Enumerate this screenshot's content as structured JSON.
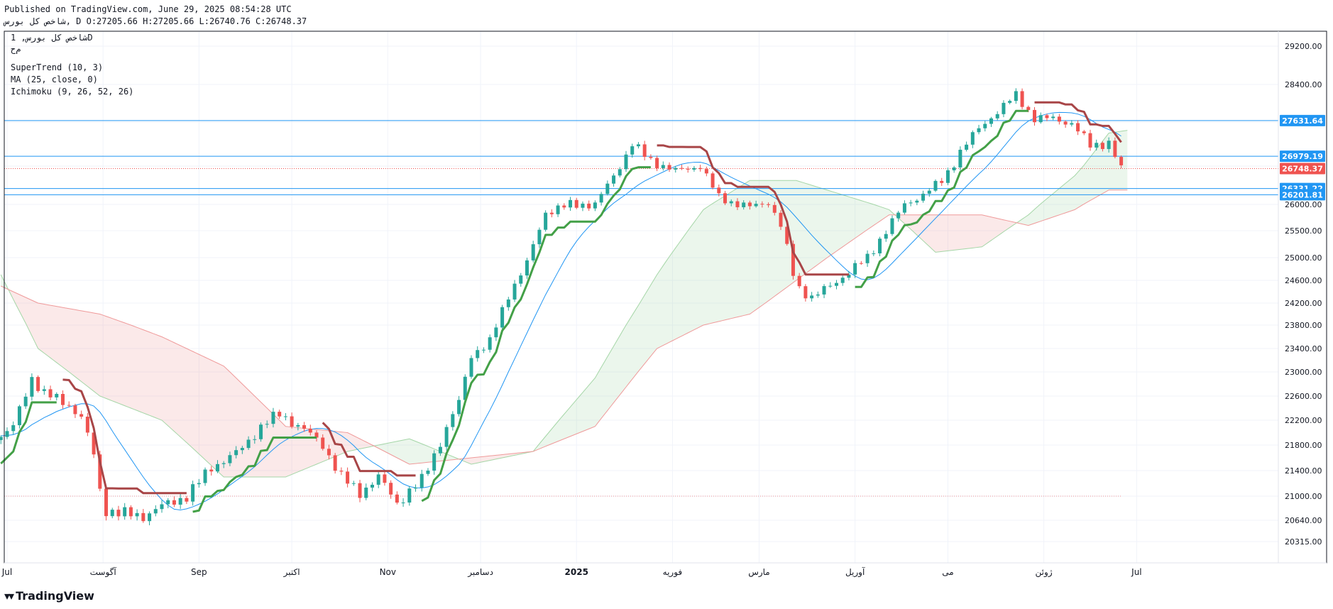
{
  "header": {
    "published": "Published on TradingView.com, June 29, 2025 08:54:28 UTC",
    "ohlc": "شاخص کل بورس, D O:27205.66 H:27205.66 L:26740.76 C:26748.37"
  },
  "legend": {
    "symbol": "شاخص کل بورس, 1D",
    "line2": "م‌ح",
    "supertrend": "SuperTrend (10, 3)",
    "ma": "MA (25, close, 0)",
    "ichimoku": "Ichimoku (9, 26, 52, 26)"
  },
  "footer": {
    "logo_icon": "tradingview-logo-icon",
    "brand": "TradingView"
  },
  "colors": {
    "up": "#26a69a",
    "down": "#ef5350",
    "st_up": "#43a047",
    "st_down": "#a84547",
    "ma": "#2196f3",
    "cloud_bull": "#a5d6a7",
    "cloud_bear": "#ef9a9a",
    "hline": "#2196f3"
  },
  "chart_data": {
    "type": "candlestick",
    "y_axis_ticks": [
      29200,
      28400,
      27600,
      26800,
      26000,
      25500,
      25000,
      24600,
      24200,
      23800,
      23400,
      23000,
      22600,
      22200,
      21800,
      21400,
      21000,
      20640,
      20315
    ],
    "x_axis_labels": [
      {
        "label": "Jul",
        "day": 0
      },
      {
        "label": "آگوست",
        "day": 31
      },
      {
        "label": "Sep",
        "day": 62
      },
      {
        "label": "اکتبر",
        "day": 92
      },
      {
        "label": "Nov",
        "day": 123
      },
      {
        "label": "دسامبر",
        "day": 153
      },
      {
        "label": "2025",
        "day": 184
      },
      {
        "label": "فوریه",
        "day": 215
      },
      {
        "label": "مارس",
        "day": 243
      },
      {
        "label": "آوریل",
        "day": 274
      },
      {
        "label": "می",
        "day": 304
      },
      {
        "label": "ژوئن",
        "day": 335
      },
      {
        "label": "Jul",
        "day": 365
      }
    ],
    "price_labels": [
      {
        "value": 27631.64,
        "text": "27631.64",
        "color": "#2196f3"
      },
      {
        "value": 26979.19,
        "text": "26979.19",
        "color": "#2196f3"
      },
      {
        "value": 26748.37,
        "text": "26748.37",
        "color": "#ef5350"
      },
      {
        "value": 26331.22,
        "text": "26331.22",
        "color": "#2196f3"
      },
      {
        "value": 26201.81,
        "text": "26201.81",
        "color": "#2196f3"
      }
    ],
    "horizontal_lines": [
      27631.64,
      26979.19,
      26331.22,
      26201.81
    ],
    "current_price": 26748.37,
    "reference_level": 21000,
    "trend_anchors": [
      {
        "day": -2,
        "price": 21950
      },
      {
        "day": 2,
        "price": 22100
      },
      {
        "day": 8,
        "price": 22900
      },
      {
        "day": 12,
        "price": 22650
      },
      {
        "day": 16,
        "price": 22550
      },
      {
        "day": 20,
        "price": 22450
      },
      {
        "day": 24,
        "price": 22250
      },
      {
        "day": 28,
        "price": 21650
      },
      {
        "day": 31,
        "price": 20800
      },
      {
        "day": 36,
        "price": 20750
      },
      {
        "day": 44,
        "price": 20700
      },
      {
        "day": 50,
        "price": 20850
      },
      {
        "day": 58,
        "price": 21000
      },
      {
        "day": 66,
        "price": 21450
      },
      {
        "day": 75,
        "price": 21700
      },
      {
        "day": 83,
        "price": 22150
      },
      {
        "day": 88,
        "price": 22300
      },
      {
        "day": 96,
        "price": 22050
      },
      {
        "day": 102,
        "price": 21800
      },
      {
        "day": 108,
        "price": 21300
      },
      {
        "day": 114,
        "price": 21050
      },
      {
        "day": 120,
        "price": 21300
      },
      {
        "day": 126,
        "price": 20900
      },
      {
        "day": 134,
        "price": 21250
      },
      {
        "day": 140,
        "price": 21850
      },
      {
        "day": 146,
        "price": 22500
      },
      {
        "day": 150,
        "price": 23300
      },
      {
        "day": 156,
        "price": 23500
      },
      {
        "day": 162,
        "price": 24350
      },
      {
        "day": 168,
        "price": 24900
      },
      {
        "day": 174,
        "price": 25850
      },
      {
        "day": 182,
        "price": 26000
      },
      {
        "day": 190,
        "price": 26000
      },
      {
        "day": 196,
        "price": 26600
      },
      {
        "day": 202,
        "price": 27200
      },
      {
        "day": 208,
        "price": 26900
      },
      {
        "day": 216,
        "price": 26700
      },
      {
        "day": 224,
        "price": 26800
      },
      {
        "day": 230,
        "price": 26150
      },
      {
        "day": 234,
        "price": 26050
      },
      {
        "day": 240,
        "price": 25950
      },
      {
        "day": 246,
        "price": 26050
      },
      {
        "day": 250,
        "price": 25600
      },
      {
        "day": 255,
        "price": 24500
      },
      {
        "day": 260,
        "price": 24300
      },
      {
        "day": 266,
        "price": 24500
      },
      {
        "day": 272,
        "price": 24750
      },
      {
        "day": 278,
        "price": 25000
      },
      {
        "day": 284,
        "price": 25500
      },
      {
        "day": 290,
        "price": 26000
      },
      {
        "day": 296,
        "price": 26200
      },
      {
        "day": 302,
        "price": 26500
      },
      {
        "day": 308,
        "price": 27050
      },
      {
        "day": 314,
        "price": 27500
      },
      {
        "day": 320,
        "price": 27800
      },
      {
        "day": 326,
        "price": 28200
      },
      {
        "day": 332,
        "price": 27650
      },
      {
        "day": 338,
        "price": 27700
      },
      {
        "day": 344,
        "price": 27550
      },
      {
        "day": 350,
        "price": 27200
      },
      {
        "day": 356,
        "price": 27200
      },
      {
        "day": 360,
        "price": 26750
      }
    ],
    "ma_start": 21950,
    "cloud_a_anchors": [
      {
        "day": -2,
        "price": 24700
      },
      {
        "day": 10,
        "price": 23400
      },
      {
        "day": 30,
        "price": 22600
      },
      {
        "day": 50,
        "price": 22200
      },
      {
        "day": 70,
        "price": 21300
      },
      {
        "day": 90,
        "price": 21300
      },
      {
        "day": 110,
        "price": 21700
      },
      {
        "day": 130,
        "price": 21900
      },
      {
        "day": 150,
        "price": 21500
      },
      {
        "day": 170,
        "price": 21700
      },
      {
        "day": 190,
        "price": 22900
      },
      {
        "day": 210,
        "price": 24700
      },
      {
        "day": 225,
        "price": 25900
      },
      {
        "day": 240,
        "price": 26500
      },
      {
        "day": 255,
        "price": 26500
      },
      {
        "day": 270,
        "price": 26200
      },
      {
        "day": 285,
        "price": 25900
      },
      {
        "day": 300,
        "price": 25100
      },
      {
        "day": 315,
        "price": 25200
      },
      {
        "day": 330,
        "price": 25800
      },
      {
        "day": 345,
        "price": 26600
      },
      {
        "day": 356,
        "price": 27400
      },
      {
        "day": 362,
        "price": 27450
      }
    ],
    "cloud_b_anchors": [
      {
        "day": -2,
        "price": 24500
      },
      {
        "day": 10,
        "price": 24200
      },
      {
        "day": 30,
        "price": 24000
      },
      {
        "day": 50,
        "price": 23600
      },
      {
        "day": 70,
        "price": 23100
      },
      {
        "day": 90,
        "price": 22100
      },
      {
        "day": 110,
        "price": 22000
      },
      {
        "day": 130,
        "price": 21500
      },
      {
        "day": 150,
        "price": 21600
      },
      {
        "day": 170,
        "price": 21700
      },
      {
        "day": 190,
        "price": 22100
      },
      {
        "day": 210,
        "price": 23400
      },
      {
        "day": 225,
        "price": 23800
      },
      {
        "day": 240,
        "price": 24000
      },
      {
        "day": 255,
        "price": 24600
      },
      {
        "day": 270,
        "price": 25200
      },
      {
        "day": 285,
        "price": 25800
      },
      {
        "day": 300,
        "price": 25800
      },
      {
        "day": 315,
        "price": 25800
      },
      {
        "day": 330,
        "price": 25600
      },
      {
        "day": 345,
        "price": 25900
      },
      {
        "day": 356,
        "price": 26300
      },
      {
        "day": 362,
        "price": 26300
      }
    ]
  }
}
